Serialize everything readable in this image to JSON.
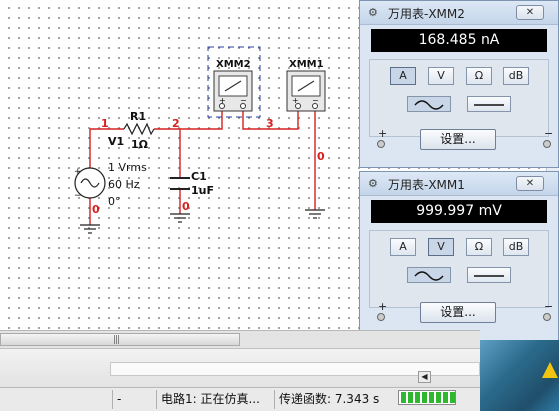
{
  "circuit": {
    "source": {
      "name": "V1",
      "line1": "1 Vrms",
      "line2": "60 Hz",
      "line3": "0°"
    },
    "resistor": {
      "name": "R1",
      "value": "1Ω"
    },
    "capacitor": {
      "name": "C1",
      "value": "1uF"
    },
    "nodes": {
      "n1": "1",
      "n2": "2",
      "n3": "3",
      "g1": "0",
      "g2": "0",
      "g3": "0"
    },
    "xmm2_label": "XMM2",
    "xmm1_label": "XMM1",
    "plus": "+",
    "minus": "−"
  },
  "meter1": {
    "title": "万用表-XMM2",
    "close": "✕",
    "reading": "168.485 nA",
    "buttons": [
      "A",
      "V",
      "Ω",
      "dB"
    ],
    "active_button": "A",
    "active_wave": "ac",
    "settings_label": "设置...",
    "plus": "+",
    "minus": "−"
  },
  "meter2": {
    "title": "万用表-XMM1",
    "close": "✕",
    "reading": "999.997 mV",
    "buttons": [
      "A",
      "V",
      "Ω",
      "dB"
    ],
    "active_button": "V",
    "active_wave": "ac",
    "settings_label": "设置...",
    "plus": "+",
    "minus": "−"
  },
  "nav": {
    "prev": "◀",
    "next": "▶"
  },
  "status": {
    "cell1": "-",
    "cell2": "电路1: 正在仿真...",
    "cell3": "传递函数: 7.343 s"
  },
  "icons": {
    "meter_icon": "multimeter-icon",
    "warning": "warning-icon"
  },
  "colors": {
    "wire": "#d62020",
    "node_label": "#d62020",
    "display_bg": "#000000",
    "progress": "#2fb82f"
  }
}
